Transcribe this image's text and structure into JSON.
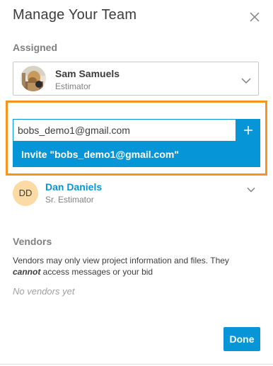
{
  "dialog": {
    "title": "Manage Your Team",
    "close_icon": "close-icon"
  },
  "assigned": {
    "label": "Assigned",
    "members": [
      {
        "name": "Sam Samuels",
        "role": "Estimator",
        "avatar": "photo"
      }
    ]
  },
  "invite": {
    "input_value": "bobs_demo1@gmail.com",
    "add_icon": "plus-icon",
    "suggestion": "Invite \"bobs_demo1@gmail.com\""
  },
  "team": {
    "members": [
      {
        "initials": "DD",
        "name": "Dan Daniels",
        "role": "Sr. Estimator"
      }
    ]
  },
  "vendors": {
    "label": "Vendors",
    "desc_before": "Vendors may only view project information and files. They ",
    "desc_emphasis": "cannot",
    "desc_after": " access messages or your bid",
    "empty_text": "No vendors yet"
  },
  "footer": {
    "done_label": "Done"
  },
  "colors": {
    "accent": "#0696d7",
    "highlight": "#f7941d",
    "avatar_bg": "#fbdba3"
  }
}
